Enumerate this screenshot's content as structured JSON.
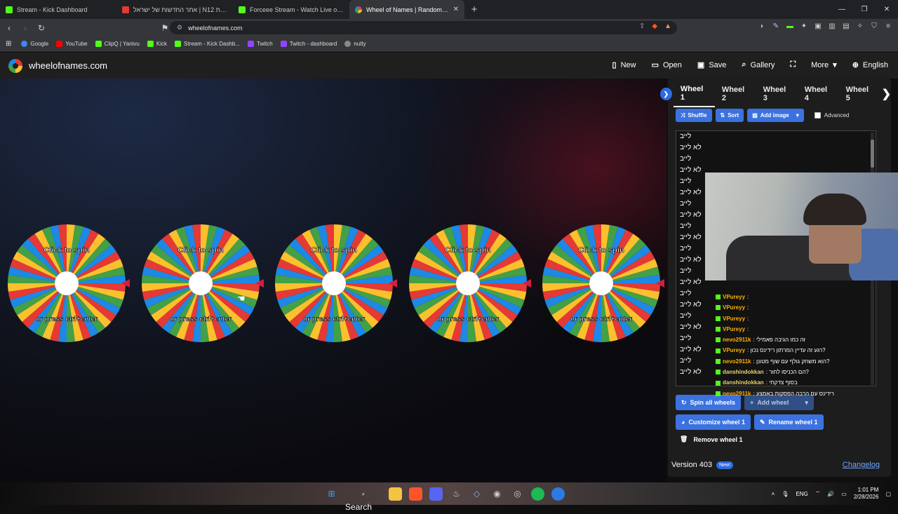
{
  "browser": {
    "tabs": [
      {
        "label": "Stream - Kick Dashboard",
        "color": "#53fc18"
      },
      {
        "label": "אתר החדשות של ישראל | N12 חדשות",
        "color": "#e53935"
      },
      {
        "label": "Forceee Stream - Watch Live on Kick",
        "color": "#53fc18"
      },
      {
        "label": "Wheel of Names | Random name",
        "color": "#3b72e0"
      }
    ],
    "url": "wheelofnames.com",
    "bookmarks": [
      {
        "label": "Google",
        "color": "#4285f4"
      },
      {
        "label": "YouTube",
        "color": "#ff0000"
      },
      {
        "label": "ClipQ | Yanivu",
        "color": "#53fc18"
      },
      {
        "label": "Kick",
        "color": "#53fc18"
      },
      {
        "label": "Stream - Kick Dashb...",
        "color": "#53fc18"
      },
      {
        "label": "Twitch",
        "color": "#9146ff"
      },
      {
        "label": "Twitch - dashboard",
        "color": "#9146ff"
      },
      {
        "label": "nutty",
        "color": "#888888"
      }
    ]
  },
  "site": {
    "name": "wheelofnames.com",
    "menu": [
      {
        "label": "New",
        "icon": "file-icon"
      },
      {
        "label": "Open",
        "icon": "folder-icon"
      },
      {
        "label": "Save",
        "icon": "save-icon"
      },
      {
        "label": "Gallery",
        "icon": "search-icon"
      },
      {
        "label": "",
        "icon": "fullscreen-icon"
      },
      {
        "label": "More",
        "icon": "chevron-down-icon"
      },
      {
        "label": "English",
        "icon": "globe-icon"
      }
    ]
  },
  "wheels": {
    "count": 5,
    "text_top": "Click to spin",
    "text_bottom": "or press ctrl+enter",
    "colors": [
      "#e53935",
      "#fbc02d",
      "#43a047",
      "#1e88e5"
    ]
  },
  "panel": {
    "wheel_tabs": [
      "Wheel 1",
      "Wheel 2",
      "Wheel 3",
      "Wheel 4",
      "Wheel 5"
    ],
    "shuffle": "Shuffle",
    "sort": "Sort",
    "add_image": "Add image",
    "advanced": "Advanced",
    "entries": [
      "לייב",
      "לא לייב",
      "לייב",
      "לא לייב",
      "לייב",
      "לא לייב",
      "לייב",
      "לא לייב",
      "לייב",
      "לא לייב",
      "לייב",
      "לא לייב",
      "לייב",
      "לא לייב",
      "לייב",
      "לא לייב",
      "לייב",
      "לא לייב",
      "לייב",
      "לא לייב",
      "לייב",
      "לא לייב"
    ],
    "spin_all": "Spin all wheels",
    "add_wheel": "Add wheel",
    "customize": "Customize wheel 1",
    "rename": "Rename wheel 1",
    "remove": "Remove wheel 1",
    "version": "Version 403",
    "new_badge": "New!",
    "changelog": "Changelog"
  },
  "chat": [
    {
      "user": "VPureyy",
      "text": ":",
      "color": "#ffb000"
    },
    {
      "user": "VPureyy",
      "text": ":",
      "color": "#ffb000"
    },
    {
      "user": "VPureyy",
      "text": ":",
      "color": "#ffb000"
    },
    {
      "user": "VPureyy",
      "text": ":",
      "color": "#ffb000"
    },
    {
      "user": "nevo2911k",
      "text": ": זה כמו הגיבה פאמילי",
      "color": "#ffb000"
    },
    {
      "user": "VPureyy",
      "text": ": רגע זה עדיין המרתון רידינס נכון?",
      "color": "#ffb000"
    },
    {
      "user": "nevo2911k",
      "text": ": הוא משחק גולף עם שוף מטונן?",
      "color": "#ffb000"
    },
    {
      "user": "danshindokkan",
      "text": ": הם הכניסו לחור?",
      "color": "#e6d36b"
    },
    {
      "user": "danshindokkan",
      "text": ": בסוף צדקתי",
      "color": "#e6d36b"
    },
    {
      "user": "nevo2911k",
      "text": ": רידינס עם הרבה הפסקות באמצע",
      "color": "#ffb000"
    }
  ],
  "taskbar": {
    "search": "Search",
    "lang": "ENG",
    "time": "1:01 PM",
    "date": "2/28/2026"
  }
}
